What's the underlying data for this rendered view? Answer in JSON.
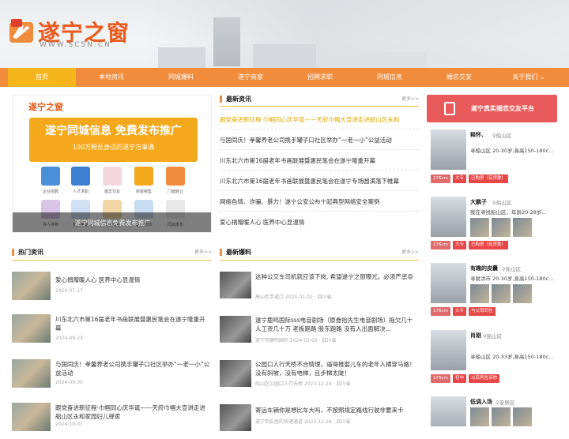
{
  "site": {
    "brand": "遂宁之窗",
    "domain": "WWW.SCSN.CN"
  },
  "nav": [
    "首页",
    "本地资讯",
    "同城爆料",
    "遂宁商家",
    "招聘求职",
    "同城信息",
    "婚恋交友",
    "关于我们"
  ],
  "banner": {
    "logo": "遂宁之窗",
    "title": "遂宁同城信息  免费发布推广",
    "subtitle": "100万粉丝身边的遂宁万事通",
    "icons": [
      "企业招聘",
      "人才求职",
      "婚恋交友",
      "房屋租售",
      "门面转让",
      "寻人寻物",
      "便民电话",
      "二手交易",
      "教育培训",
      "同城发布"
    ],
    "caption": "遂宁同城信息免费发布推广"
  },
  "latest_news": {
    "title": "最新资讯",
    "more": "更多>>",
    "items": [
      "跟党奋进新征程·巾帼同心庆华诞——天府巾帼大宣讲走进船山区永和",
      "与国同庆！孝馨养老公司携手罐子口社区举办“一老一小”公益活动",
      "川东北六市第16届老年书画联展暨惠民笔会在遂宁隆重开幕",
      "川东北六市第16届老年书画联展暨惠民笔会在遂宁专场圆满落下帷幕",
      "网络色情、诈骗、暴力！遂宁公安公布十起典型网络安全案例",
      "爱心捐赠暖人心 医养中心显温情"
    ]
  },
  "hot_news": {
    "title": "热门资讯",
    "more": "更多>>",
    "items": [
      {
        "title": "爱心捐赠暖人心 医养中心显温情",
        "date": "2024-07-17"
      },
      {
        "title": "川东北六市第16届老年书画联展暨惠民笔会在遂宁隆重开幕",
        "date": "2024-09-23"
      },
      {
        "title": "与国同庆！孝馨养老公司携手罐子口社区举办“一老一小”公益活动",
        "date": "2024-09-30"
      },
      {
        "title": "跟党奋进新征程·巾帼同心庆华诞——天府巾帼大宣讲走进船山区永和家园妇儿驿家",
        "date": "2024-10-01"
      }
    ]
  },
  "latest_reports": {
    "title": "最新爆料",
    "more": "更多>>",
    "items": [
      {
        "title": "这种公交车司机就应该下岗, 希望遂宁之窗曝光。必须严惩😡",
        "meta": "高山街手道口  2024-01-02 · 四川省"
      },
      {
        "title": "遂宁鹿鸣国际sss电音剧场（原叁拾先生电音剧场）拖欠几十人工资几十万 老板跑路 股东跑路 没有人出面解决...",
        "meta": "遂宁市鹿鸣国际  2024-01-02 · 四川省"
      },
      {
        "title": "公园口人行天桥不合情理，逼得推婴儿车的老年人横穿马路！没有斜坡，没有电梯，且步梯太陡！",
        "meta": "船山区公园口人行天桥  2023-12-29 · 四川省"
      },
      {
        "title": "寄远车辆你是想比车大吗，不按照规定路线行驶非要来卡",
        "meta": "遂宁到安居的快速通道  2023-12-26 · 四川省"
      }
    ]
  },
  "dating": {
    "promo": "遂宁真实婚恋交友平台",
    "people": [
      {
        "name": "释怀、",
        "loc": "船山区",
        "line": "寻船山区 20-30岁,身高150-180c...",
        "tags": [
          "176cm",
          "大专",
          "已购房（有贷款）"
        ]
      },
      {
        "name": "大鹏子",
        "loc": "船山区",
        "line": "我在寻找船山区，年龄20-28岁...",
        "tags": [
          "176cm",
          "大专",
          "已购房（有贷款）"
        ]
      },
      {
        "name": "有趣的皮囊",
        "loc": "船山区",
        "line": "寻射洪市 20-30岁,身高150-180c...",
        "tags": [
          "176cm",
          "大专",
          "与父母同住"
        ]
      },
      {
        "name": "肖刚",
        "loc": "船山区",
        "line": "寻船山区 20-33岁,身高150-180c...",
        "tags": [
          "175cm",
          "初中",
          "以后再告诉你"
        ]
      },
      {
        "name": "低调入场",
        "loc": "安居区",
        "line": "",
        "tags": []
      }
    ]
  }
}
